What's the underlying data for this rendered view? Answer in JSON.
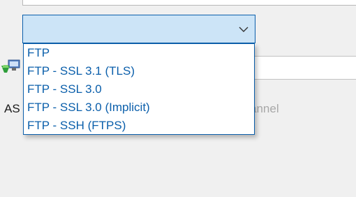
{
  "background": {
    "label_left": "AS",
    "label_right": "annel"
  },
  "protocol_select": {
    "selected_value": "",
    "options": [
      "FTP",
      "FTP - SSL 3.1 (TLS)",
      "FTP - SSL 3.0",
      "FTP - SSL 3.0 (Implicit)",
      "FTP - SSH (FTPS)"
    ]
  },
  "colors": {
    "accent": "#0b5fab",
    "select_background": "#cce4f7",
    "window_background": "#f0f0f0"
  },
  "icons": {
    "chevron": "chevron-down-icon",
    "connection": "network-connection-icon"
  }
}
